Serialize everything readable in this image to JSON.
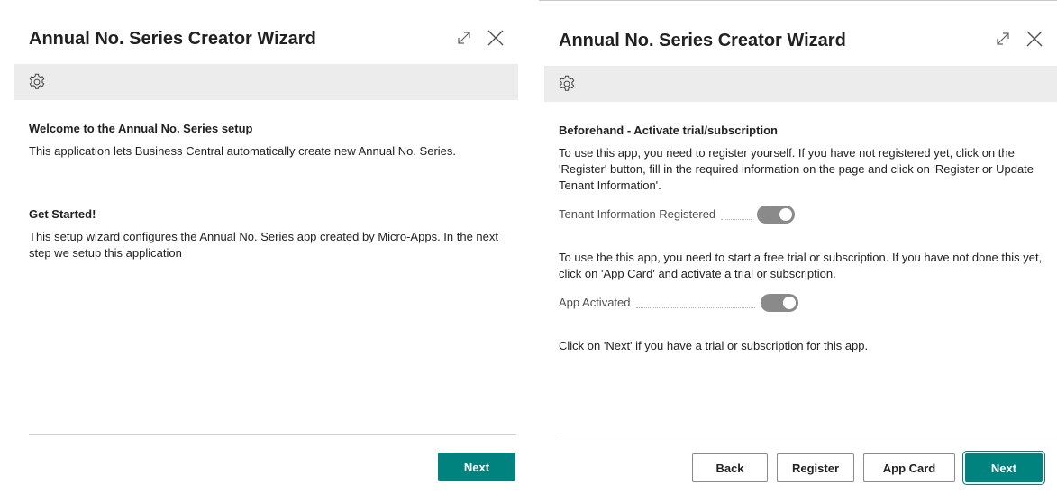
{
  "left": {
    "title": "Annual No. Series Creator Wizard",
    "welcome_heading": "Welcome to the Annual No. Series setup",
    "welcome_text": "This application lets Business Central automatically create new Annual No. Series.",
    "started_heading": "Get Started!",
    "started_text": "This setup wizard configures the Annual No. Series app created by Micro-Apps. In the next step we setup this application",
    "next_label": "Next"
  },
  "right": {
    "title": "Annual No. Series Creator Wizard",
    "heading": "Beforehand - Activate trial/subscription",
    "register_text": "To use this app, you need to register yourself. If you have not registered yet, click on the 'Register' button, fill in the required information on the page and click on 'Register or Update Tenant Information'.",
    "tenant_label": "Tenant Information Registered",
    "tenant_registered": true,
    "trial_text": "To use the this app, you need to start a free trial or subscription. If you have not done this yet, click on 'App Card' and activate a trial or subscription.",
    "activated_label": "App Activated",
    "app_activated": true,
    "next_text": "Click on 'Next' if you have a trial or subscription for this app.",
    "back_label": "Back",
    "register_label": "Register",
    "appcard_label": "App Card",
    "next_label": "Next"
  },
  "colors": {
    "accent": "#00827f",
    "toolbar_bg": "#ececec",
    "toggle_on": "#8a8a8a"
  },
  "icons": {
    "expand": "expand-icon",
    "close": "close-icon",
    "settings": "gear-icon"
  }
}
